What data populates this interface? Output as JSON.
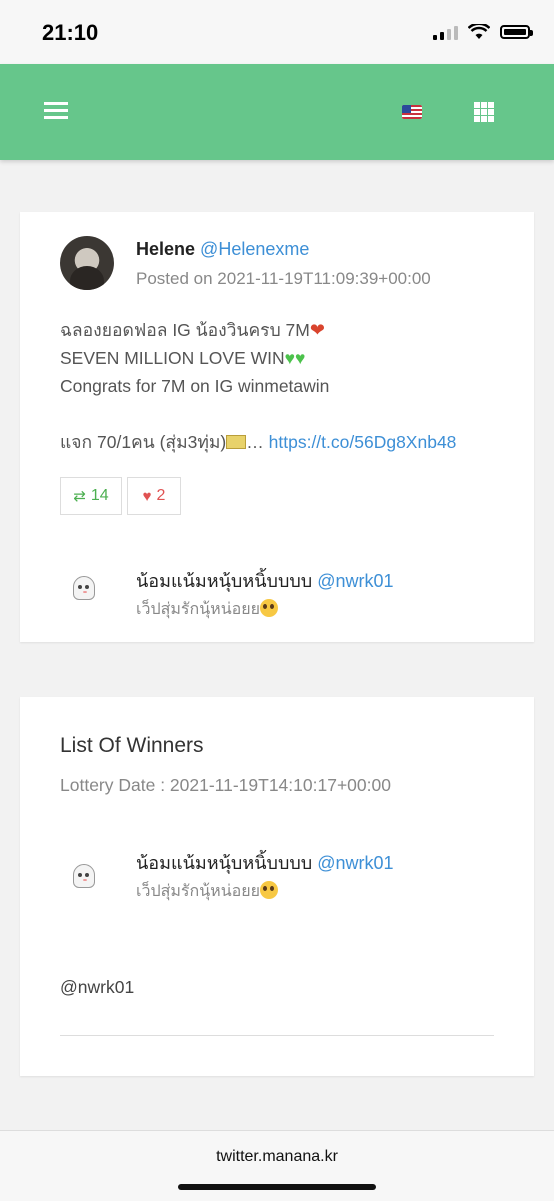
{
  "status_bar": {
    "time": "21:10"
  },
  "header": {
    "accent": "#66c68b",
    "menu_icon": "hamburger-icon",
    "flag_icon": "us-flag-icon",
    "apps_icon": "grid-icon"
  },
  "post": {
    "author_name": "Helene",
    "author_handle": "@Helenexme",
    "posted": "Posted on 2021-11-19T11:09:39+00:00",
    "line1": "ฉลองยอดฟอล IG น้องวินครบ 7M",
    "line2": "SEVEN MILLION LOVE WIN",
    "line3": "Congrats for 7M on IG winmetawin",
    "line4_text": "แจก 70/1คน (สุ่ม3ทุ่ม)",
    "line4_ellipsis": "…",
    "line4_link": "https://t.co/56Dg8Xnb48",
    "retweets": "14",
    "likes": "2"
  },
  "commenter": {
    "name": "น้อมแน้มหนุ้บหนิ้บบบบ",
    "handle": "@nwrk01",
    "description": "เว็ปสุ่มรักนุ้หน่อยย"
  },
  "winners": {
    "title": "List Of Winners",
    "lottery_date": "Lottery Date : 2021-11-19T14:10:17+00:00",
    "winner_name": "น้อมแน้มหนุ้บหนิ้บบบบ",
    "winner_handle": "@nwrk01",
    "winner_description": "เว็ปสุ่มรักนุ้หน่อยย",
    "winner_list_entry": "@nwrk01"
  },
  "footer": {
    "url": "twitter.manana.kr"
  }
}
